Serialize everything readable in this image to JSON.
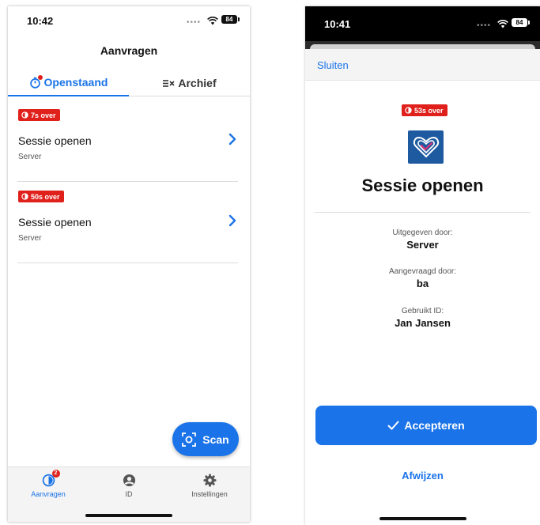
{
  "left": {
    "status": {
      "time": "10:42",
      "battery": "84"
    },
    "title": "Aanvragen",
    "tabs": [
      {
        "label": "Openstaand",
        "active": true
      },
      {
        "label": "Archief",
        "active": false
      }
    ],
    "requests": [
      {
        "timer": "7s over",
        "title": "Sessie openen",
        "subtitle": "Server"
      },
      {
        "timer": "50s over",
        "title": "Sessie openen",
        "subtitle": "Server"
      }
    ],
    "scan_label": "Scan",
    "nav": [
      {
        "label": "Aanvragen",
        "badge": "2",
        "active": true
      },
      {
        "label": "ID",
        "active": false
      },
      {
        "label": "Instellingen",
        "active": false
      }
    ]
  },
  "right": {
    "status": {
      "time": "10:41",
      "battery": "84"
    },
    "close_label": "Sluiten",
    "timer": "53s over",
    "title": "Sessie openen",
    "fields": [
      {
        "label": "Uitgegeven door:",
        "value": "Server"
      },
      {
        "label": "Aangevraagd door:",
        "value": "ba"
      },
      {
        "label": "Gebruikt ID:",
        "value": "Jan Jansen"
      }
    ],
    "accept_label": "Accepteren",
    "reject_label": "Afwijzen"
  },
  "colors": {
    "accent": "#1a73e8",
    "badge": "#e0201b",
    "logo_bg": "#1e5aa0"
  },
  "icons": [
    "timer-icon",
    "archive-icon",
    "chevron-right-icon",
    "scan-icon",
    "account-icon",
    "gear-icon",
    "check-icon",
    "heart-logo",
    "wifi-icon"
  ]
}
